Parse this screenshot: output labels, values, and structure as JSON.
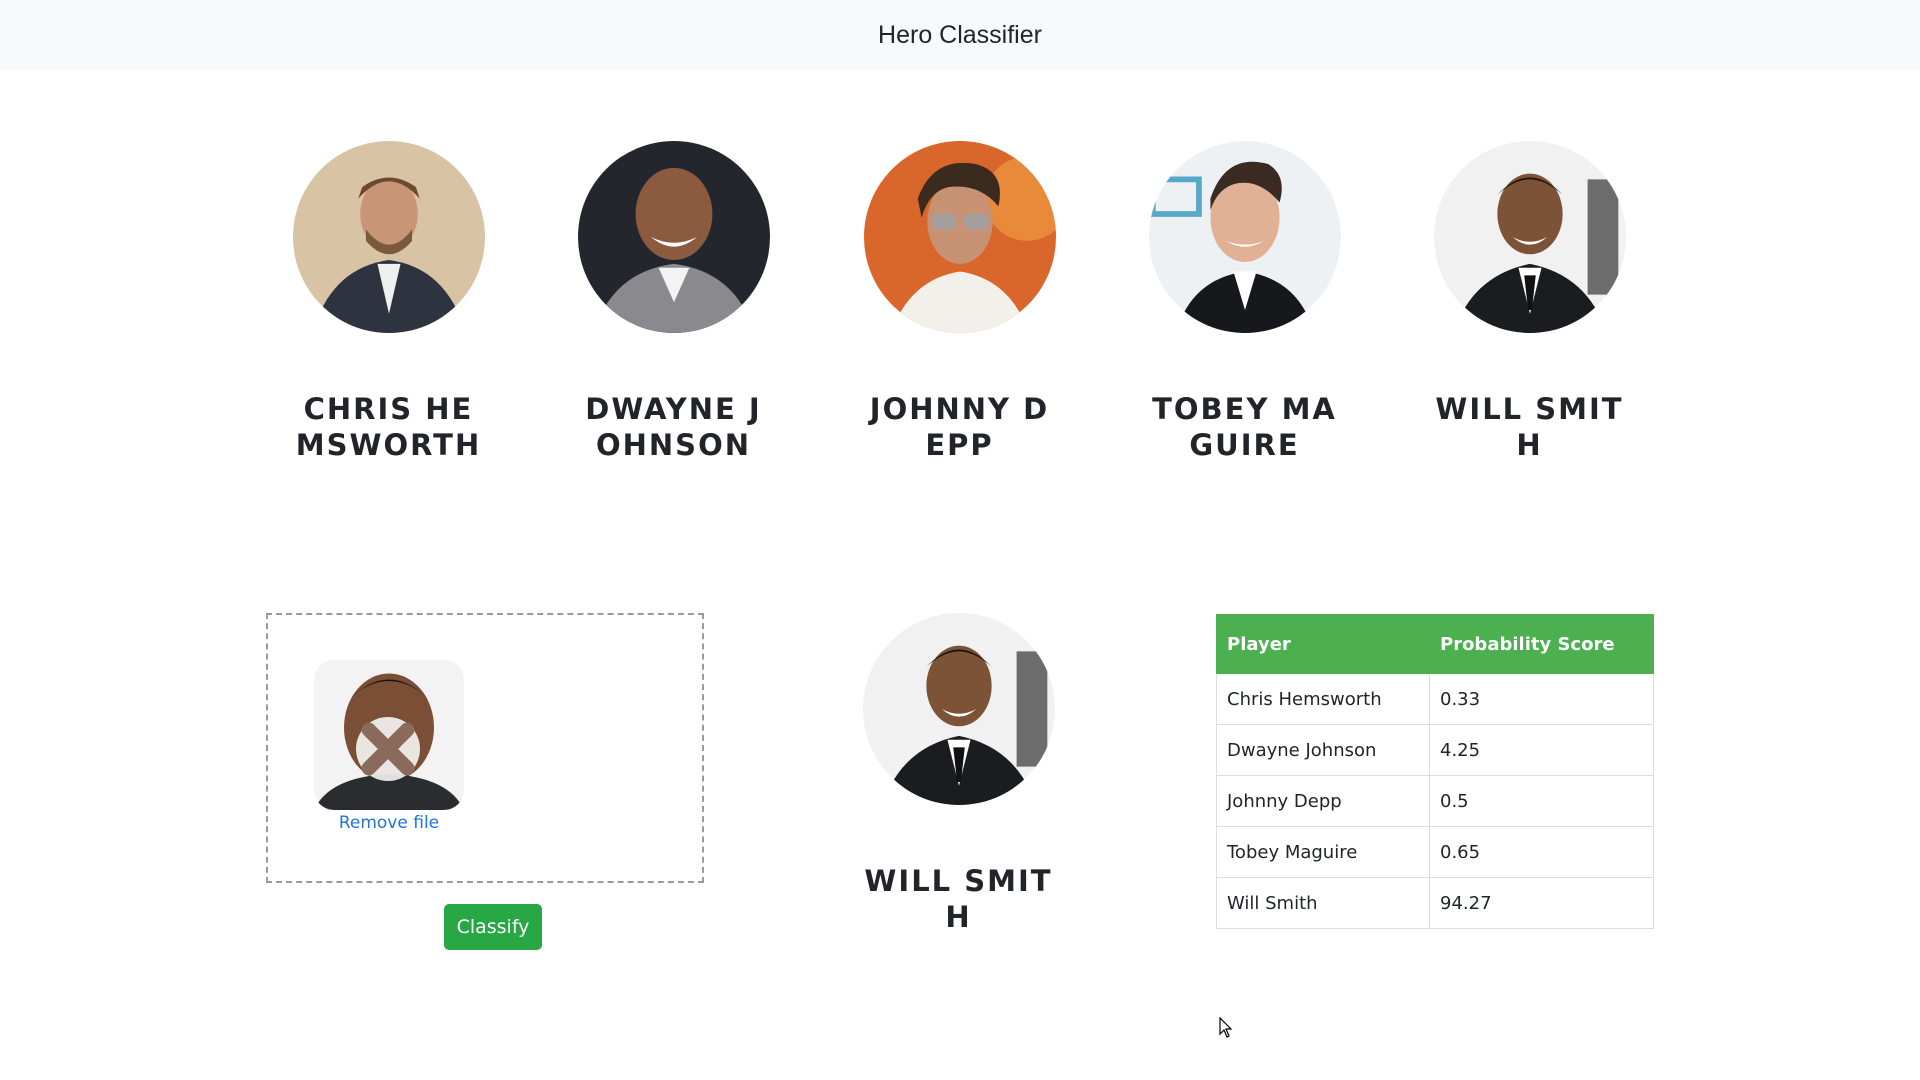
{
  "navbar": {
    "title": "Hero Classifier"
  },
  "heroes": [
    {
      "name": "CHRIS HEMSWORTH",
      "image": "chris-hemsworth-photo"
    },
    {
      "name": "DWAYNE JOHNSON",
      "image": "dwayne-johnson-photo"
    },
    {
      "name": "JOHNNY DEPP",
      "image": "johnny-depp-photo"
    },
    {
      "name": "TOBEY MAGUIRE",
      "image": "tobey-maguire-photo"
    },
    {
      "name": "WILL SMITH",
      "image": "will-smith-photo"
    }
  ],
  "upload": {
    "remove_label": "Remove file",
    "preview_icon": "upload-error-icon",
    "classify_label": "Classify"
  },
  "result": {
    "name": "WILL SMITH",
    "image": "will-smith-photo"
  },
  "table": {
    "headers": [
      "Player",
      "Probability Score"
    ],
    "rows": [
      [
        "Chris Hemsworth",
        "0.33"
      ],
      [
        "Dwayne Johnson",
        "4.25"
      ],
      [
        "Johnny Depp",
        "0.5"
      ],
      [
        "Tobey Maguire",
        "0.65"
      ],
      [
        "Will Smith",
        "94.27"
      ]
    ]
  },
  "colors": {
    "navbar_bg": "#f8f9fa",
    "table_header": "#4caf50",
    "button": "#28a745",
    "link": "#1f74d6"
  }
}
